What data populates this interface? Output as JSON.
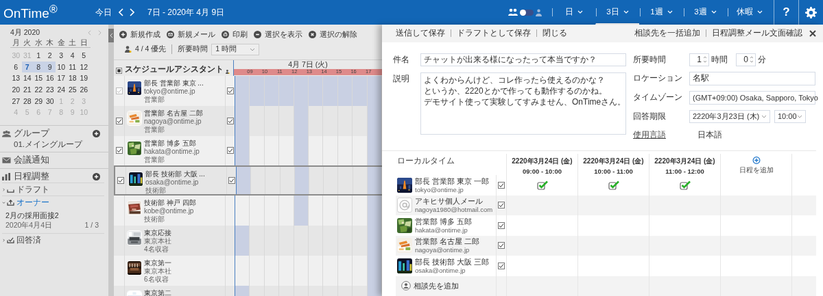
{
  "header": {
    "logo": "OnTime$^{®}$",
    "today": "今日",
    "range": "7日 - 2020年 4月 9日",
    "group_toggle": {
      "on": false
    },
    "views": [
      {
        "label": "日",
        "selected": false
      },
      {
        "label": "3日",
        "selected": true
      },
      {
        "label": "1週",
        "selected": false
      },
      {
        "label": "3週",
        "selected": false
      },
      {
        "label": "休暇",
        "selected": false
      }
    ],
    "help": "?"
  },
  "sidebar": {
    "calendar": {
      "month": "4月 2020",
      "weekdays": [
        "月",
        "火",
        "水",
        "木",
        "金",
        "土",
        "日"
      ],
      "weeks": [
        [
          {
            "d": "30",
            "muted": true,
            "selected": false,
            "today": false
          },
          {
            "d": "31",
            "muted": true,
            "selected": false,
            "today": false
          },
          {
            "d": "1",
            "muted": false,
            "selected": false,
            "today": false
          },
          {
            "d": "2",
            "muted": false,
            "selected": false,
            "today": false
          },
          {
            "d": "3",
            "muted": false,
            "selected": false,
            "today": false
          },
          {
            "d": "4",
            "muted": false,
            "selected": false,
            "today": false
          },
          {
            "d": "5",
            "muted": false,
            "selected": false,
            "today": false
          }
        ],
        [
          {
            "d": "6",
            "muted": false,
            "selected": false,
            "today": false
          },
          {
            "d": "7",
            "muted": false,
            "selected": true,
            "today": true
          },
          {
            "d": "8",
            "muted": false,
            "selected": true,
            "today": false
          },
          {
            "d": "9",
            "muted": false,
            "selected": true,
            "today": false
          },
          {
            "d": "10",
            "muted": false,
            "selected": false,
            "today": false
          },
          {
            "d": "11",
            "muted": false,
            "selected": false,
            "today": false
          },
          {
            "d": "12",
            "muted": false,
            "selected": false,
            "today": false
          }
        ],
        [
          {
            "d": "13",
            "muted": false,
            "selected": false,
            "today": false
          },
          {
            "d": "14",
            "muted": false,
            "selected": false,
            "today": false
          },
          {
            "d": "15",
            "muted": false,
            "selected": false,
            "today": false
          },
          {
            "d": "16",
            "muted": false,
            "selected": false,
            "today": false
          },
          {
            "d": "17",
            "muted": false,
            "selected": false,
            "today": false
          },
          {
            "d": "18",
            "muted": false,
            "selected": false,
            "today": false
          },
          {
            "d": "19",
            "muted": false,
            "selected": false,
            "today": false
          }
        ],
        [
          {
            "d": "20",
            "muted": false,
            "selected": false,
            "today": false
          },
          {
            "d": "21",
            "muted": false,
            "selected": false,
            "today": false
          },
          {
            "d": "22",
            "muted": false,
            "selected": false,
            "today": false
          },
          {
            "d": "23",
            "muted": false,
            "selected": false,
            "today": false
          },
          {
            "d": "24",
            "muted": false,
            "selected": false,
            "today": false
          },
          {
            "d": "25",
            "muted": false,
            "selected": false,
            "today": false
          },
          {
            "d": "26",
            "muted": false,
            "selected": false,
            "today": false
          }
        ],
        [
          {
            "d": "27",
            "muted": false,
            "selected": false,
            "today": false
          },
          {
            "d": "28",
            "muted": false,
            "selected": false,
            "today": false
          },
          {
            "d": "29",
            "muted": false,
            "selected": false,
            "today": false
          },
          {
            "d": "30",
            "muted": false,
            "selected": false,
            "today": false
          },
          {
            "d": "1",
            "muted": true,
            "selected": false,
            "today": false
          },
          {
            "d": "2",
            "muted": true,
            "selected": false,
            "today": false
          },
          {
            "d": "3",
            "muted": true,
            "selected": false,
            "today": false
          }
        ],
        [
          {
            "d": "4",
            "muted": true,
            "selected": false,
            "today": false
          },
          {
            "d": "5",
            "muted": true,
            "selected": false,
            "today": false
          },
          {
            "d": "6",
            "muted": true,
            "selected": false,
            "today": false
          },
          {
            "d": "7",
            "muted": true,
            "selected": false,
            "today": false
          },
          {
            "d": "8",
            "muted": true,
            "selected": false,
            "today": false
          },
          {
            "d": "9",
            "muted": true,
            "selected": false,
            "today": false
          },
          {
            "d": "10",
            "muted": true,
            "selected": false,
            "today": false
          }
        ]
      ]
    },
    "group": {
      "title": "グループ",
      "subtitle": "01.メイングループ"
    },
    "notices": "会議通知",
    "scheduling": {
      "title": "日程調整",
      "items": [
        {
          "kind": "draft",
          "label": "ドラフト",
          "expanded": false
        },
        {
          "kind": "owner",
          "label": "オーナー",
          "expanded": true,
          "children": [
            {
              "title": "2月の採用面接2",
              "date": "2020年4月4日",
              "count": "1 / 3"
            }
          ]
        },
        {
          "kind": "answered",
          "label": "回答済",
          "expanded": false
        }
      ]
    }
  },
  "toolbar": {
    "actions": [
      {
        "kind": "plus",
        "label": "新規作成"
      },
      {
        "kind": "mail",
        "label": "新規メール"
      },
      {
        "kind": "print",
        "label": "印刷"
      },
      {
        "kind": "minus",
        "label": "選択を表示"
      },
      {
        "kind": "close",
        "label": "選択の解除"
      }
    ],
    "priority": "4 / 4 優先",
    "duration_label": "所要時間",
    "duration": "1 時間"
  },
  "schedule": {
    "select_all": {
      "indeterminate": true
    },
    "title": "スケジュールアシスタント",
    "date": "4月 7日 (火)",
    "hours": [
      "09",
      "10",
      "11",
      "12",
      "13",
      "14",
      "15",
      "16",
      "17"
    ],
    "rows": [
      {
        "name": "部長 営業部 東京 ...",
        "line2": "tokyo@ontime.jp",
        "line3": "営業部",
        "checkable": true,
        "checked": true,
        "disabled": true,
        "right_checked": true,
        "selected": false,
        "busy": [
          true,
          true,
          true,
          true,
          true,
          true,
          true,
          true,
          true,
          true
        ]
      },
      {
        "name": "営業部 名古屋 二郎",
        "line2": "nagoya@ontime.jp",
        "line3": "営業部",
        "checkable": true,
        "checked": true,
        "disabled": false,
        "right_checked": true,
        "selected": false,
        "busy": [
          true,
          false,
          false,
          false,
          true,
          false,
          false,
          false,
          false,
          true
        ]
      },
      {
        "name": "営業部 博多 五郎",
        "line2": "hakata@ontime.jp",
        "line3": "営業部",
        "checkable": true,
        "checked": true,
        "disabled": false,
        "right_checked": true,
        "selected": false,
        "busy": [
          true,
          false,
          false,
          false,
          true,
          false,
          false,
          false,
          false,
          true
        ]
      },
      {
        "name": "部長 技術部 大阪 ...",
        "line2": "osaka@ontime.jp",
        "line3": "技術部",
        "checkable": true,
        "checked": true,
        "disabled": false,
        "right_checked": true,
        "selected": true,
        "busy": [
          true,
          false,
          false,
          false,
          true,
          false,
          false,
          false,
          false,
          true
        ]
      },
      {
        "name": "技術部 神戸 四郎",
        "line2": "kobe@ontime.jp",
        "line3": "技術部",
        "checkable": false,
        "selected": false,
        "busy": [
          false,
          false,
          false,
          false,
          true,
          false,
          false,
          false,
          false,
          true
        ]
      },
      {
        "name": "東京応接",
        "line2": "東京本社",
        "line3": "4名収容",
        "checkable": false,
        "selected": false,
        "busy": [
          true,
          false,
          false,
          false,
          false,
          false,
          false,
          false,
          false,
          true
        ]
      },
      {
        "name": "東京第一",
        "line2": "東京本社",
        "line3": "6名収容",
        "checkable": false,
        "selected": false,
        "busy": [
          false,
          false,
          false,
          false,
          false,
          false,
          false,
          false,
          false,
          true
        ]
      },
      {
        "name": "東京第二",
        "checkable": false,
        "selected": false,
        "busy": [
          true,
          false,
          false,
          false,
          false,
          false,
          false,
          false,
          false,
          true
        ]
      }
    ]
  },
  "editor": {
    "actions_left": [
      "送信して保存",
      "ドラフトとして保存",
      "閉じる"
    ],
    "actions_right": [
      "相談先を一括追加",
      "日程調整メール文面確認"
    ],
    "subject_label": "件名",
    "subject": "チャットが出来る様になったって本当ですか？",
    "description_label": "説明",
    "description": [
      "よくわからんけど、コレ作ったら使えるのかな？",
      "というか、2220とかで作っても動作するのかね。",
      "デモサイト使って実験してすみません、OnTimeさん。"
    ],
    "duration_label": "所要時間",
    "hours": "1",
    "hours_unit": "時間",
    "minutes": "0",
    "minutes_unit": "分",
    "location_label": "ロケーション",
    "location": "名駅",
    "timezone_label": "タイムゾーン",
    "timezone": "(GMT+09:00) Osaka, Sapporo, Tokyo",
    "deadline_label": "回答期限",
    "deadline_date": "2220年3月23日 (木)",
    "deadline_time": "10:00",
    "language_label": "使用言語",
    "language": "日本語",
    "table": {
      "header": "ローカルタイム",
      "slots": [
        {
          "date": "2220年3月24日 (金)",
          "time": "09:00 - 10:00"
        },
        {
          "date": "2220年3月24日 (金)",
          "time": "10:00 - 11:00"
        },
        {
          "date": "2220年3月24日 (金)",
          "time": "11:00 - 12:00"
        }
      ],
      "add_slot": "日程を追加",
      "rows": [
        {
          "kind": "person",
          "name": "部長 営業部 東京 一郎",
          "email": "tokyo@ontime.jp",
          "checked": true,
          "answers": [
            true,
            true,
            true
          ]
        },
        {
          "kind": "address",
          "name": "アキヒサ個人メール",
          "email": "nagoya1980@hotmail.com",
          "checked": true,
          "answers": [
            false,
            false,
            false
          ]
        },
        {
          "kind": "person",
          "name": "営業部 博多 五郎",
          "email": "hakata@ontime.jp",
          "checked": true,
          "answers": [
            false,
            false,
            false
          ]
        },
        {
          "kind": "person",
          "name": "営業部 名古屋 二郎",
          "email": "nagoya@ontime.jp",
          "checked": true,
          "answers": [
            false,
            false,
            false
          ]
        },
        {
          "kind": "person",
          "name": "部長 技術部 大阪 三郎",
          "email": "osaka@ontime.jp",
          "checked": true,
          "answers": [
            false,
            false,
            false
          ]
        }
      ],
      "add_attendee": "相談先を追加"
    }
  }
}
